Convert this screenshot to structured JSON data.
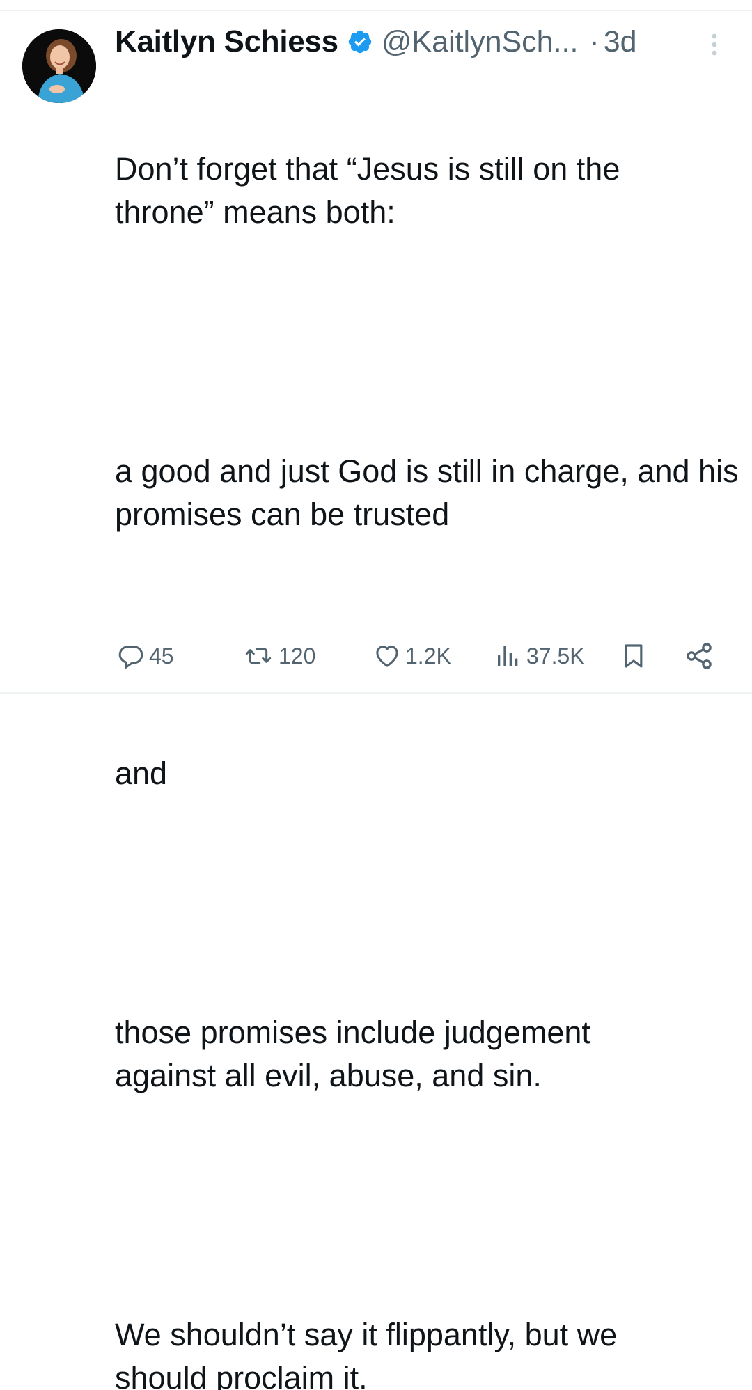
{
  "tweet": {
    "author": {
      "display_name": "Kaitlyn Schiess",
      "handle": "@KaitlynSch...",
      "verified": true,
      "avatar_icon": "profile-photo"
    },
    "separator": "·",
    "time": "3d",
    "paragraphs": [
      "Don’t forget that “Jesus is still on the throne” means both:",
      "a good and just God is still in charge, and his promises can be trusted",
      "and",
      "those promises include judgement against all evil, abuse, and sin.",
      "We shouldn’t say it flippantly, but we should proclaim it."
    ],
    "actions": {
      "replies": "45",
      "retweets": "120",
      "likes": "1.2K",
      "views": "37.5K"
    }
  },
  "colors": {
    "text": "#0f1419",
    "muted": "#536471",
    "verified_blue": "#1d9bf0",
    "divider": "#eff3f4"
  }
}
